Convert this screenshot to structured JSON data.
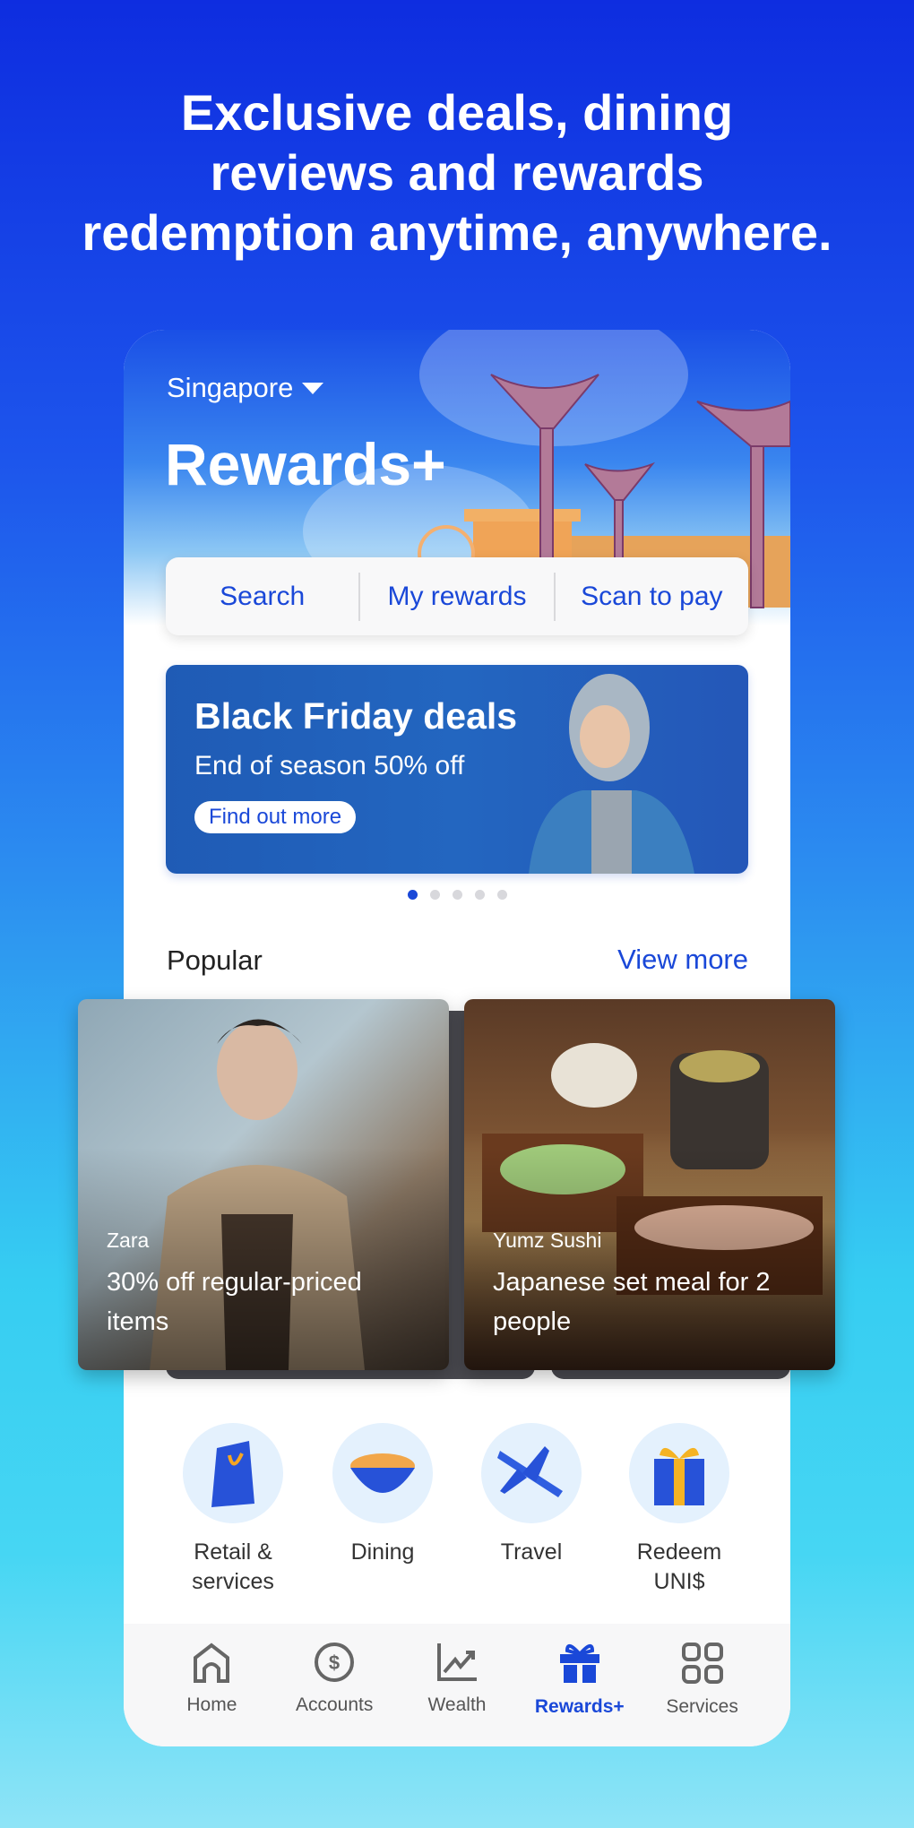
{
  "headline": [
    "Exclusive deals, dining",
    "reviews and rewards",
    "redemption anytime, anywhere."
  ],
  "header": {
    "location": "Singapore",
    "title": "Rewards+"
  },
  "quick_actions": [
    "Search",
    "My rewards",
    "Scan to pay"
  ],
  "banner": {
    "title": "Black Friday deals",
    "subtitle": "End of season 50% off",
    "cta": "Find out more",
    "active_slide": 1,
    "slide_count": 5
  },
  "popular": {
    "title": "Popular",
    "view_more": "View more",
    "cards": [
      {
        "brand": "Zara",
        "deal": "30% off regular-priced items"
      },
      {
        "brand": "Yumz Sushi",
        "deal": "Japanese set meal for 2 people"
      }
    ]
  },
  "categories": [
    {
      "label": "Retail &\nservices",
      "icon": "shopping-bag-icon"
    },
    {
      "label": "Dining",
      "icon": "noodle-bowl-icon"
    },
    {
      "label": "Travel",
      "icon": "airplane-icon"
    },
    {
      "label": "Redeem\nUNI$",
      "icon": "gift-box-icon"
    }
  ],
  "nav": [
    {
      "label": "Home",
      "icon": "home-icon"
    },
    {
      "label": "Accounts",
      "icon": "dollar-circle-icon"
    },
    {
      "label": "Wealth",
      "icon": "chart-up-icon"
    },
    {
      "label": "Rewards+",
      "icon": "gift-icon",
      "active": true
    },
    {
      "label": "Services",
      "icon": "grid-icon"
    }
  ],
  "colors": {
    "accent": "#1a48d8",
    "bg_top": "#0e2de0",
    "bg_bottom": "#8fe4f7"
  }
}
